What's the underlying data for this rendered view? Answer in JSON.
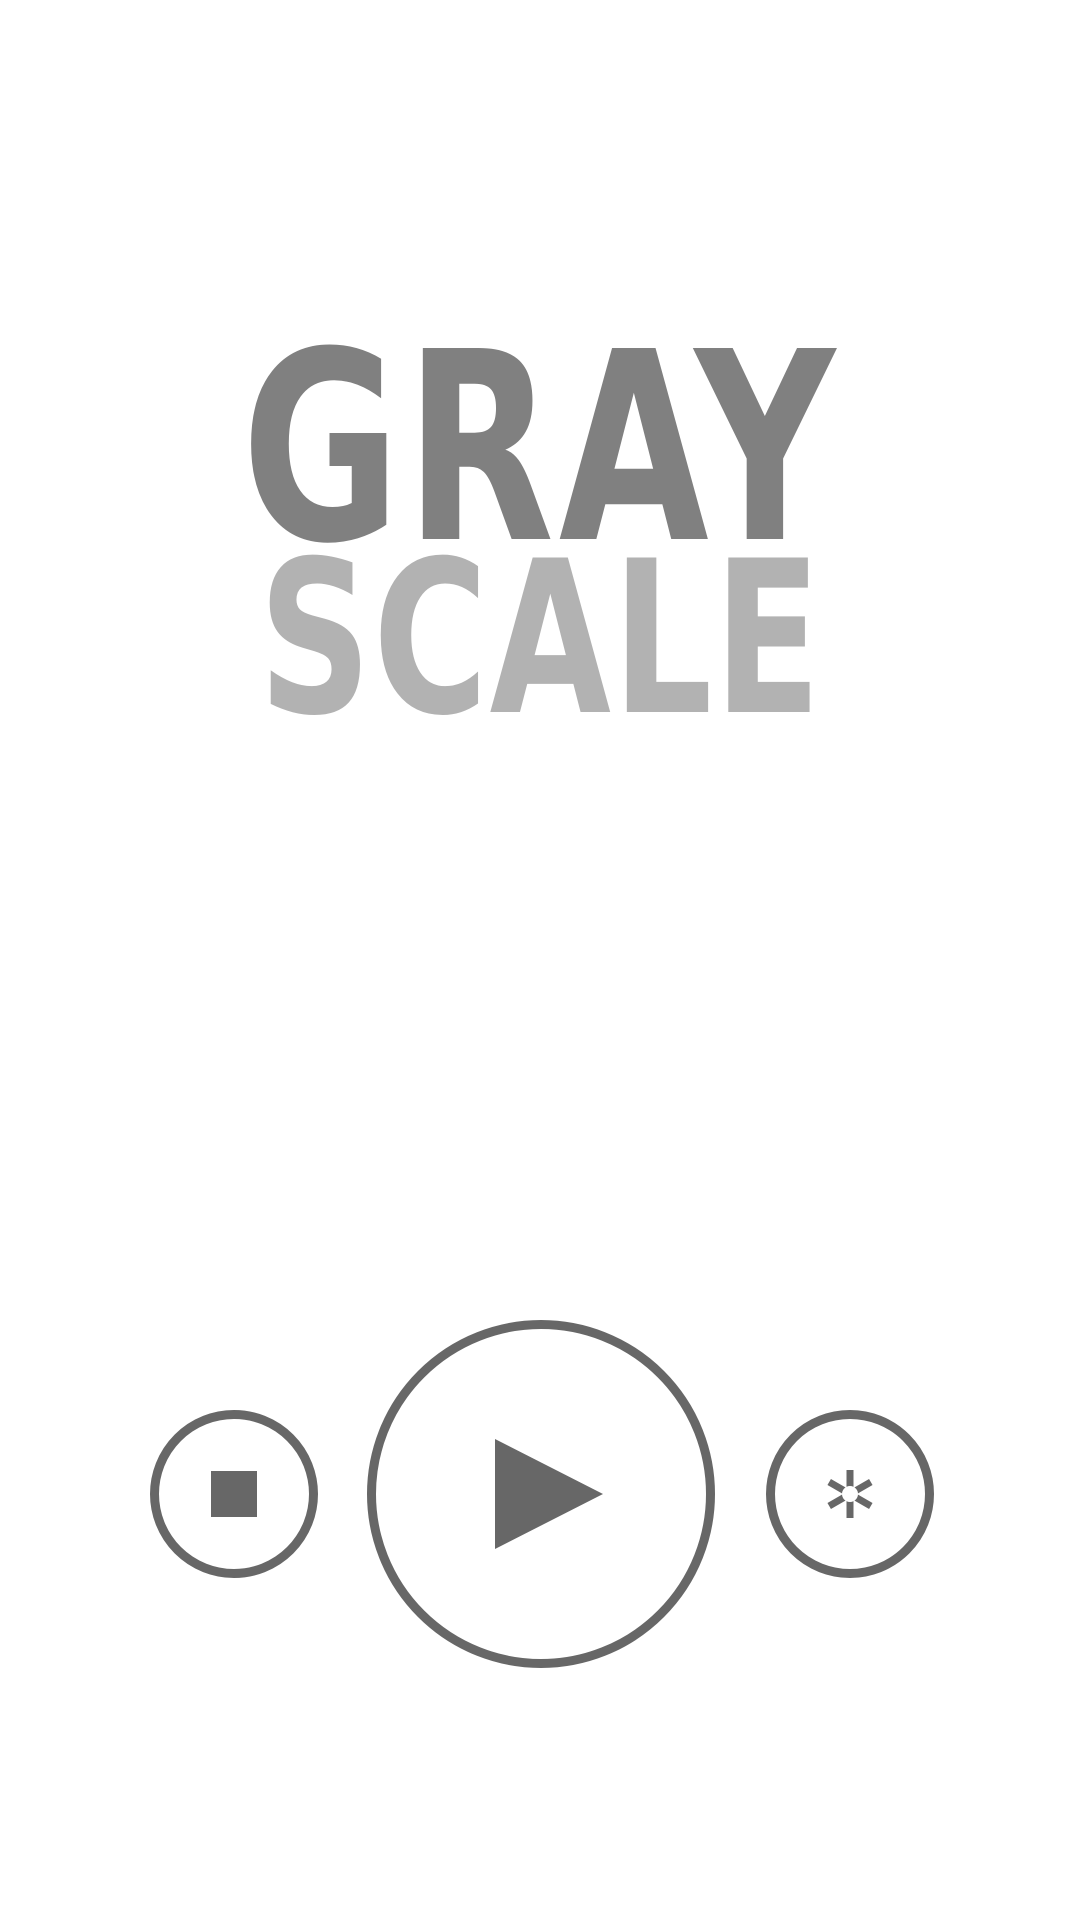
{
  "title": {
    "line1": "GRAY",
    "line2": "SCALE"
  },
  "colors": {
    "title_primary": "#808080",
    "title_secondary": "#b2b2b2",
    "control": "#676767",
    "background": "#ffffff"
  },
  "controls": {
    "stop": {
      "icon": "square-stop-icon"
    },
    "play": {
      "icon": "play-triangle-icon"
    },
    "settings": {
      "icon": "asterisk-icon"
    }
  }
}
